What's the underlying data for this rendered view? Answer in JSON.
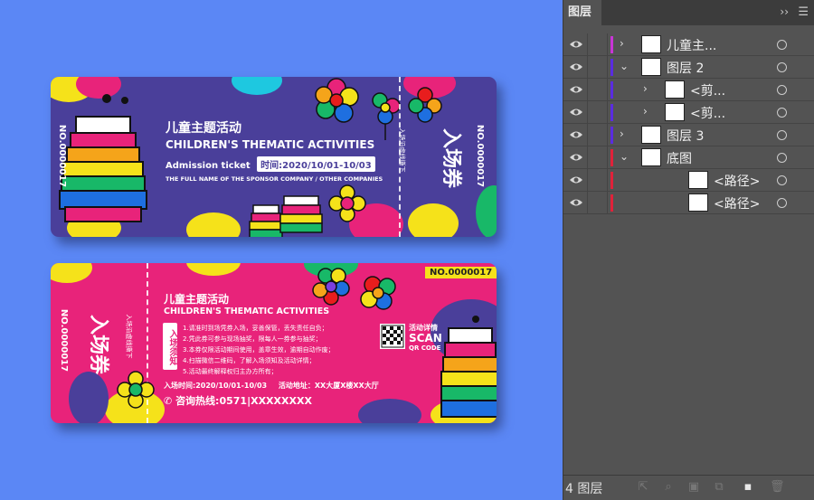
{
  "canvas": {
    "background_color": "#5b87f5"
  },
  "ticket_top": {
    "title_cn": "儿童主题活动",
    "title_en": "CHILDREN'S THEMATIC ACTIVITIES",
    "admission": "Admission ticket",
    "date": "时间:2020/10/01-10/03",
    "sponsor": "THE FULL NAME OF THE SPONSOR COMPANY / OTHER COMPANIES",
    "serial_left": "NO.0000017",
    "serial_right": "NO.0000017",
    "tear_hint": "入场沿虚线撕下",
    "entry_label": "入场券",
    "base_color": "#4a3f9a"
  },
  "ticket_bottom": {
    "title_cn": "儿童主题活动",
    "title_en": "CHILDREN'S THEMATIC ACTIVITIES",
    "notice_label": "入场须知",
    "rules": [
      "1.请准时到场凭券入场，妥善保管，丢失责任自负；",
      "2.凭此券可参与现场抽奖，限每人一券参与抽奖；",
      "3.本券仅限活动期间使用，盖章生效，逾期自动作废；",
      "4.扫描微信二维码，了解入场须知及活动详情；",
      "5.活动最终解释权归主办方所有；"
    ],
    "time_line": "入场时间:2020/10/01-10/03",
    "address_line": "活动地址：XX大厦X楼XX大厅",
    "hotline": "咨询热线:0571|XXXXXXXX",
    "qr_title": "活动详情",
    "qr_scan": "SCAN",
    "qr_code": "QR CODE",
    "serial_top": "NO.0000017",
    "serial_left": "NO.0000017",
    "tear_hint": "入场沿虚线撕下",
    "entry_label": "入场券",
    "base_color": "#e8237a"
  },
  "layers_panel": {
    "tab": "图层",
    "collapse_icon": "double-chevron-right-icon",
    "menu_icon": "hamburger-menu-icon",
    "layers": [
      {
        "label": "儿童主...",
        "indent": 0,
        "expanded": false,
        "bar_color": "#c935d6",
        "has_twisty": true
      },
      {
        "label": "图层 2",
        "indent": 0,
        "expanded": true,
        "bar_color": "#5b2ce0",
        "has_twisty": true
      },
      {
        "label": "<剪...",
        "indent": 1,
        "expanded": false,
        "bar_color": "#5b2ce0",
        "has_twisty": true
      },
      {
        "label": "<剪...",
        "indent": 1,
        "expanded": false,
        "bar_color": "#5b2ce0",
        "has_twisty": true
      },
      {
        "label": "图层 3",
        "indent": 0,
        "expanded": false,
        "bar_color": "#5b2ce0",
        "has_twisty": true
      },
      {
        "label": "底图",
        "indent": 0,
        "expanded": true,
        "bar_color": "#e0223a",
        "has_twisty": true
      },
      {
        "label": "<路径>",
        "indent": 2,
        "expanded": false,
        "bar_color": "#e0223a",
        "has_twisty": false
      },
      {
        "label": "<路径>",
        "indent": 2,
        "expanded": false,
        "bar_color": "#e0223a",
        "has_twisty": false
      }
    ],
    "layer_count": "4 图层"
  }
}
